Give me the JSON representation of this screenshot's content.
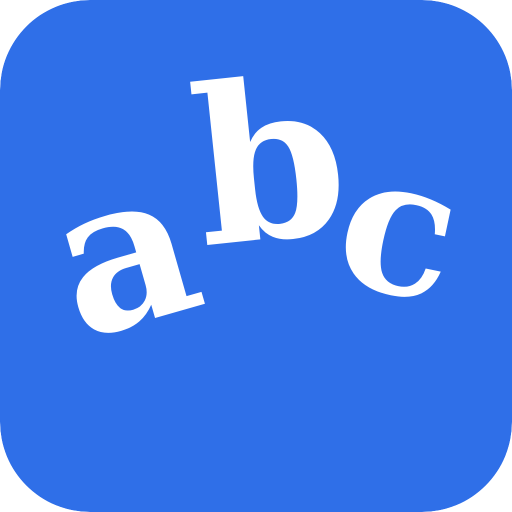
{
  "icon": {
    "name": "abc",
    "background_color": "#2f6fe8",
    "foreground_color": "#ffffff",
    "letters": [
      "a",
      "b",
      "c"
    ]
  }
}
